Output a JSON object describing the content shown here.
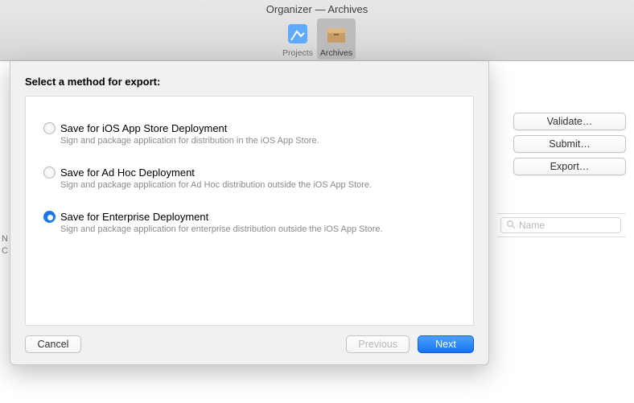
{
  "window": {
    "title": "Organizer — Archives",
    "tabs": {
      "projects": "Projects",
      "archives": "Archives"
    }
  },
  "side": {
    "validate": "Validate…",
    "submit": "Submit…",
    "export": "Export…",
    "search_placeholder": "Name"
  },
  "list_hint": {
    "n": "N",
    "c": "C"
  },
  "sheet": {
    "heading": "Select a method for export:",
    "options": [
      {
        "title": "Save for iOS App Store Deployment",
        "desc": "Sign and package application for distribution in the iOS App Store.",
        "selected": false
      },
      {
        "title": "Save for Ad Hoc Deployment",
        "desc": "Sign and package application for Ad Hoc distribution outside the iOS App Store.",
        "selected": false
      },
      {
        "title": "Save for Enterprise Deployment",
        "desc": "Sign and package application for enterprise distribution outside the iOS App Store.",
        "selected": true
      }
    ],
    "buttons": {
      "cancel": "Cancel",
      "previous": "Previous",
      "next": "Next"
    }
  }
}
